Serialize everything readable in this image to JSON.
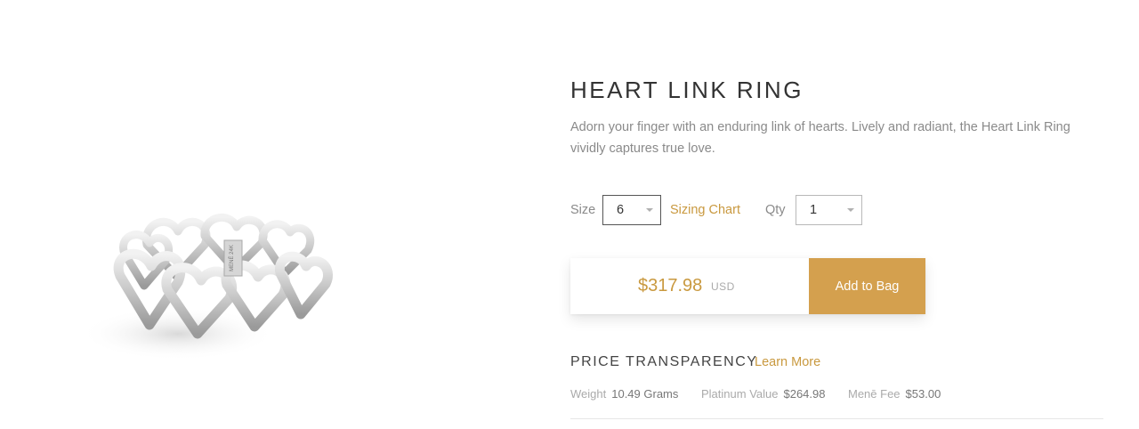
{
  "product": {
    "title": "HEART LINK RING",
    "description": "Adorn your finger with an enduring link of hearts. Lively and radiant, the Heart Link Ring vividly captures true love.",
    "image_icon": "heart-link-ring-image",
    "ring_stamp": "MENĒ 24K"
  },
  "options": {
    "size_label": "Size",
    "size_value": "6",
    "sizing_chart_label": "Sizing Chart",
    "qty_label": "Qty",
    "qty_value": "1"
  },
  "purchase": {
    "price": "$317.98",
    "currency": "USD",
    "add_to_bag_label": "Add to Bag"
  },
  "price_transparency": {
    "heading": "PRICE TRANSPARENCY",
    "learn_more_label": "Learn More",
    "items": [
      {
        "label": "Weight",
        "value": "10.49 Grams"
      },
      {
        "label": "Platinum Value",
        "value": "$264.98"
      },
      {
        "label": "Menē Fee",
        "value": "$53.00"
      }
    ]
  },
  "colors": {
    "accent": "#c9993f",
    "button": "#d4a04e"
  }
}
